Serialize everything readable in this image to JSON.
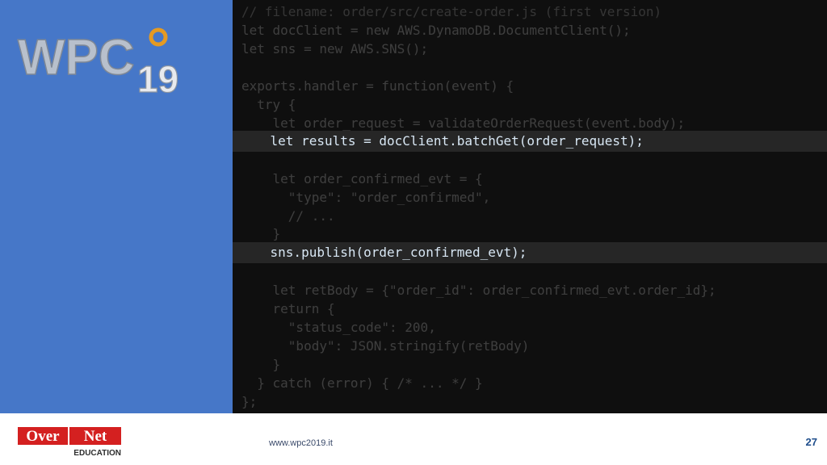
{
  "slide": {
    "logo_text": "WPC19",
    "footer": {
      "brand_over": "Over",
      "brand_net": "Net",
      "brand_sub": "EDUCATION",
      "site": "www.wpc2019.it",
      "page_number": "27"
    }
  },
  "code": {
    "lines": [
      "// filename: order/src/create-order.js (first version)",
      "let docClient = new AWS.DynamoDB.DocumentClient();",
      "let sns = new AWS.SNS();",
      "",
      "exports.handler = function(event) {",
      "  try {",
      "    let order_request = validateOrderRequest(event.body);",
      "    let results = docClient.batchGet(order_request);",
      "",
      "    let order_confirmed_evt = {",
      "      \"type\": \"order_confirmed\",",
      "      // ...",
      "    }",
      "    sns.publish(order_confirmed_evt);",
      "",
      "    let retBody = {\"order_id\": order_confirmed_evt.order_id};",
      "    return {",
      "      \"status_code\": 200,",
      "      \"body\": JSON.stringify(retBody)",
      "    }",
      "  } catch (error) { /* ... */ }",
      "};"
    ],
    "highlighted_lines": [
      7,
      13
    ]
  }
}
